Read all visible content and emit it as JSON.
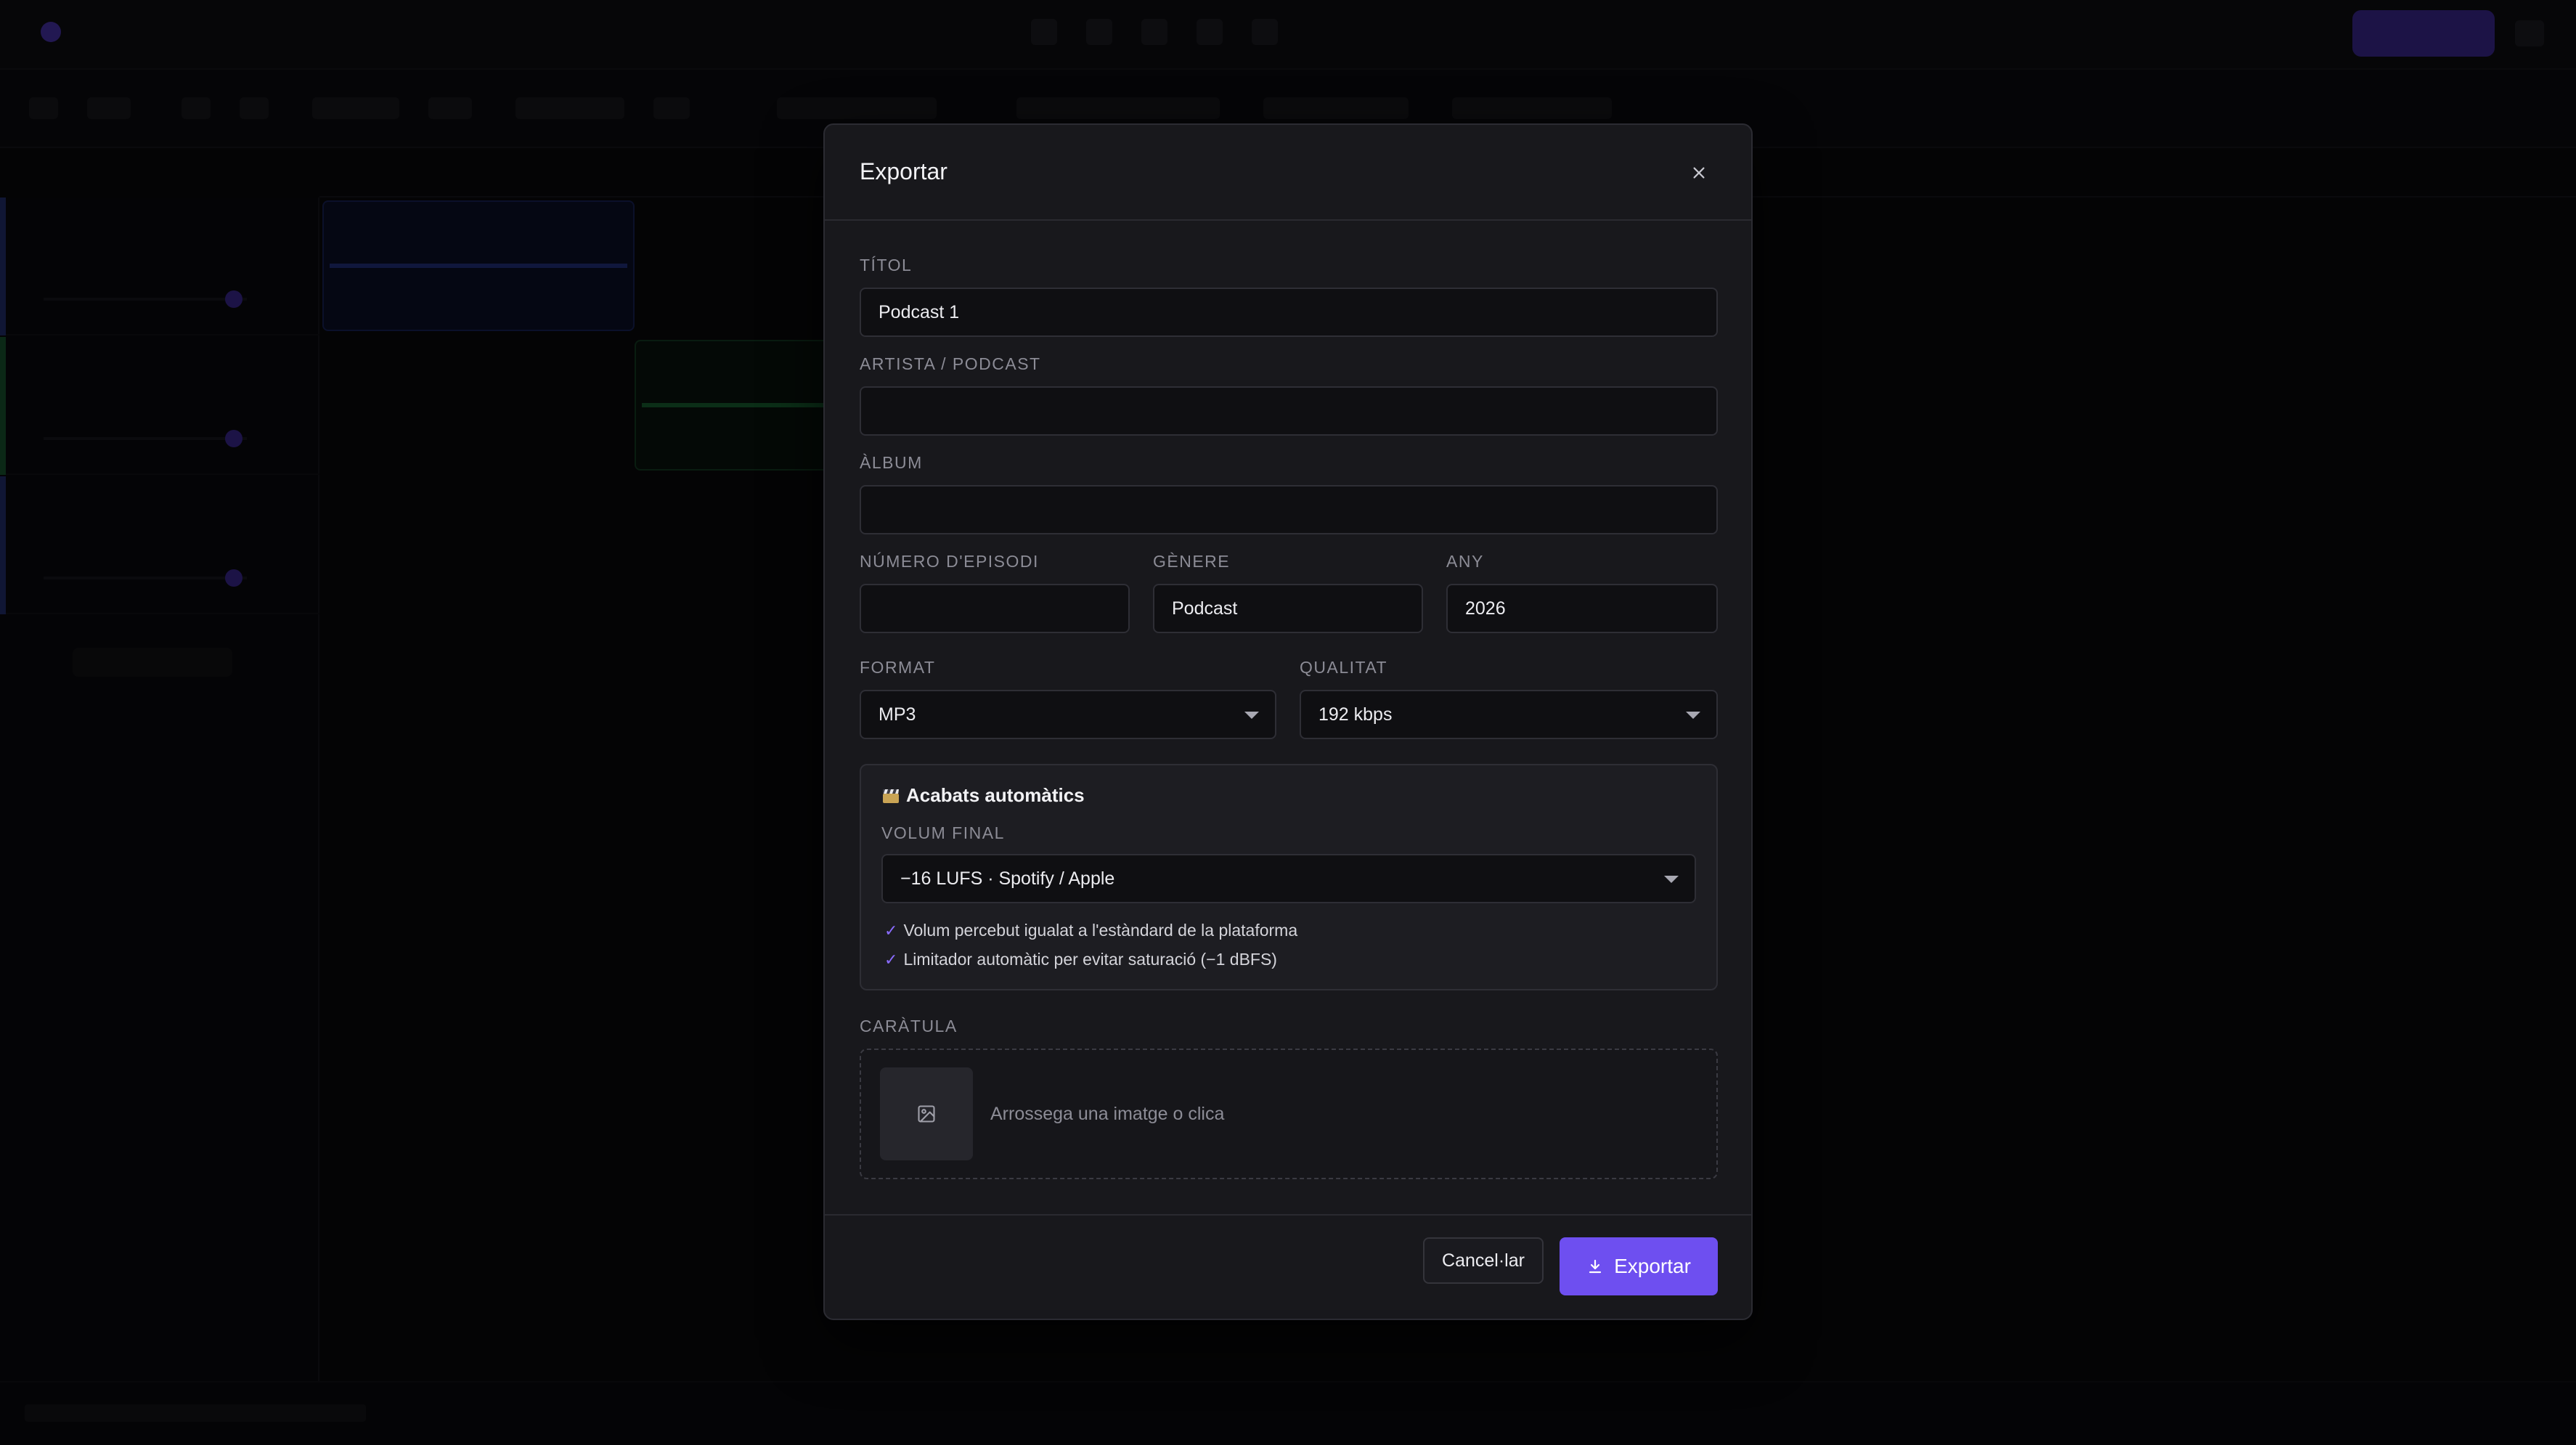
{
  "app": {
    "background_accent": "#5b3fd8"
  },
  "dialog": {
    "title": "Exportar",
    "close_icon": "close-icon",
    "fields": {
      "title": {
        "label": "Títol",
        "value": "Podcast 1",
        "placeholder": ""
      },
      "artist": {
        "label": "Artista / Podcast",
        "value": "",
        "placeholder": ""
      },
      "album": {
        "label": "Àlbum",
        "value": "",
        "placeholder": ""
      },
      "episode": {
        "label": "Número d'episodi",
        "value": "",
        "placeholder": ""
      },
      "genre": {
        "label": "Gènere",
        "value": "Podcast",
        "placeholder": ""
      },
      "year": {
        "label": "Any",
        "value": "2026",
        "placeholder": ""
      }
    },
    "format": {
      "label": "Format",
      "value": "MP3"
    },
    "quality": {
      "label": "Qualitat",
      "value": "192 kbps"
    },
    "mastering": {
      "title": "Acabats automàtics",
      "icon": "clapperboard-icon",
      "volume_label": "Volum final",
      "volume_value": "−16 LUFS · Spotify / Apple",
      "checks": [
        "Volum percebut igualat a l'estàndard de la plataforma",
        "Limitador automàtic per evitar saturació (−1 dBFS)"
      ]
    },
    "cover": {
      "label": "Caràtula",
      "dropzone_text": "Arrossega una imatge o clica",
      "icon": "image-icon"
    },
    "buttons": {
      "cancel": "Cancel·lar",
      "export": "Exportar",
      "export_icon": "download-icon"
    },
    "colors": {
      "accent": "#6e4ff0",
      "check": "#8a6cff"
    }
  }
}
